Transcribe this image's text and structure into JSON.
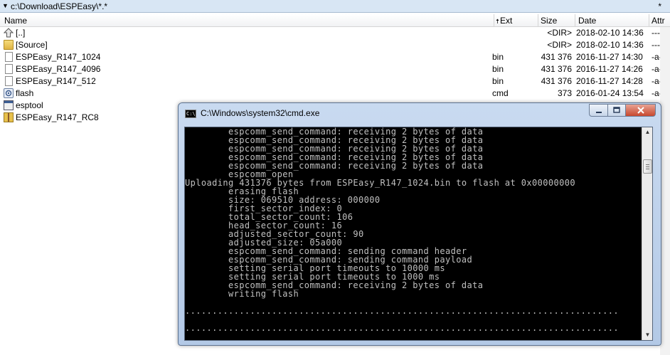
{
  "filemanager": {
    "path": "c:\\Download\\ESPEasy\\*.*",
    "star": "*",
    "columns": {
      "name": "Name",
      "ext": "Ext",
      "size": "Size",
      "date": "Date",
      "attr": "Attr"
    },
    "sort_indicator": "up-arrow-icon",
    "rows": [
      {
        "name": "[..]",
        "ext": "",
        "size": "<DIR>",
        "date": "2018-02-10 14:36",
        "attr": "----",
        "icon": "up-folder-icon"
      },
      {
        "name": "[Source]",
        "ext": "",
        "size": "<DIR>",
        "date": "2018-02-10 14:36",
        "attr": "----",
        "icon": "folder-icon"
      },
      {
        "name": "ESPEasy_R147_1024",
        "ext": "bin",
        "size": "431 376",
        "date": "2016-11-27 14:30",
        "attr": "-a--",
        "icon": "file-icon"
      },
      {
        "name": "ESPEasy_R147_4096",
        "ext": "bin",
        "size": "431 376",
        "date": "2016-11-27 14:26",
        "attr": "-a--",
        "icon": "file-icon"
      },
      {
        "name": "ESPEasy_R147_512",
        "ext": "bin",
        "size": "431 376",
        "date": "2016-11-27 14:28",
        "attr": "-a--",
        "icon": "file-icon"
      },
      {
        "name": "flash",
        "ext": "cmd",
        "size": "373",
        "date": "2016-01-24 13:54",
        "attr": "-a--",
        "icon": "script-icon"
      },
      {
        "name": "esptool",
        "ext": "",
        "size": "",
        "date": "",
        "attr": "",
        "icon": "executable-icon"
      },
      {
        "name": "ESPEasy_R147_RC8",
        "ext": "",
        "size": "",
        "date": "",
        "attr": "",
        "icon": "archive-icon"
      }
    ]
  },
  "cmd": {
    "title": "C:\\Windows\\system32\\cmd.exe",
    "icon_label": "C:\\",
    "lines": [
      "        espcomm_send_command: receiving 2 bytes of data",
      "        espcomm_send_command: receiving 2 bytes of data",
      "        espcomm_send_command: receiving 2 bytes of data",
      "        espcomm_send_command: receiving 2 bytes of data",
      "        espcomm_send_command: receiving 2 bytes of data",
      "        espcomm_open",
      "Uploading 431376 bytes from ESPEasy_R147_1024.bin to flash at 0x00000000",
      "        erasing flash",
      "        size: 069510 address: 000000",
      "        first_sector_index: 0",
      "        total_sector_count: 106",
      "        head_sector_count: 16",
      "        adjusted_sector_count: 90",
      "        adjusted_size: 05a000",
      "        espcomm_send_command: sending command header",
      "        espcomm_send_command: sending command payload",
      "        setting serial port timeouts to 10000 ms",
      "        setting serial port timeouts to 1000 ms",
      "        espcomm_send_command: receiving 2 bytes of data",
      "        writing flash",
      "",
      "................................................................................",
      "",
      "................................................................................",
      "",
      "................................................................................",
      "",
      "..............................................................................."
    ]
  }
}
